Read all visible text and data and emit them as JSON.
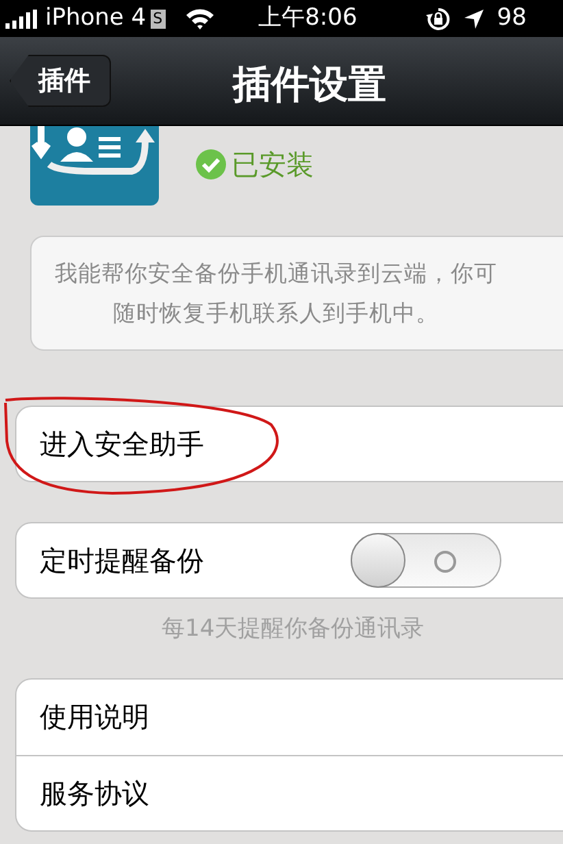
{
  "status_bar": {
    "carrier": "iPhone 4",
    "carrier_badge": "S",
    "time": "上午8:06",
    "battery": "98"
  },
  "nav_bar": {
    "back_button": "插件",
    "title": "插件设置"
  },
  "plugin": {
    "installed": true,
    "status": "已安装"
  },
  "description": {
    "lines": [
      "我能帮你安全备份手机通讯录到云端，你可",
      "随时恢复手机联系人到手机中。"
    ]
  },
  "entry": {
    "label": "进入安全助手"
  },
  "annotation": {
    "kind": "ellipse"
  },
  "reminder": {
    "label": "定时提醒备份",
    "on": false,
    "caption": "每14天提醒你备份通讯录"
  },
  "links": [
    {
      "label": "使用说明"
    },
    {
      "label": "服务协议"
    }
  ]
}
